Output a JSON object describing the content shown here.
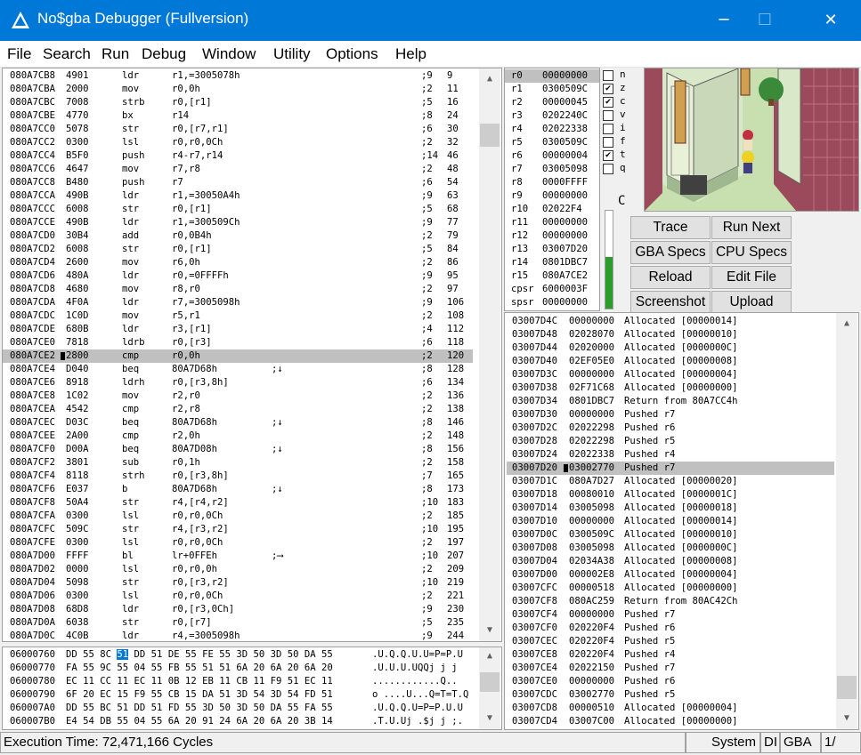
{
  "window": {
    "title": "No$gba Debugger (Fullversion)",
    "minimize": "─",
    "maximize": "☐",
    "close": "✕"
  },
  "menu": [
    "File",
    "Search",
    "Run",
    "Debug",
    "Window",
    "Utility",
    "Options",
    "Help"
  ],
  "disassembly": [
    {
      "addr": "080A7CB8",
      "op": "4901",
      "mn": "ldr",
      "args": "r1,=3005078h",
      "mark": "",
      "cyc": ";9",
      "tot": "9"
    },
    {
      "addr": "080A7CBA",
      "op": "2000",
      "mn": "mov",
      "args": "r0,0h",
      "mark": "",
      "cyc": ";2",
      "tot": "11"
    },
    {
      "addr": "080A7CBC",
      "op": "7008",
      "mn": "strb",
      "args": "r0,[r1]",
      "mark": "",
      "cyc": ";5",
      "tot": "16"
    },
    {
      "addr": "080A7CBE",
      "op": "4770",
      "mn": "bx",
      "args": "r14",
      "mark": "",
      "cyc": ";8",
      "tot": "24"
    },
    {
      "addr": "080A7CC0",
      "op": "5078",
      "mn": "str",
      "args": "r0,[r7,r1]",
      "mark": "",
      "cyc": ";6",
      "tot": "30"
    },
    {
      "addr": "080A7CC2",
      "op": "0300",
      "mn": "lsl",
      "args": "r0,r0,0Ch",
      "mark": "",
      "cyc": ";2",
      "tot": "32"
    },
    {
      "addr": "080A7CC4",
      "op": "B5F0",
      "mn": "push",
      "args": "r4-r7,r14",
      "mark": "",
      "cyc": ";14",
      "tot": "46"
    },
    {
      "addr": "080A7CC6",
      "op": "4647",
      "mn": "mov",
      "args": "r7,r8",
      "mark": "",
      "cyc": ";2",
      "tot": "48"
    },
    {
      "addr": "080A7CC8",
      "op": "B480",
      "mn": "push",
      "args": "r7",
      "mark": "",
      "cyc": ";6",
      "tot": "54"
    },
    {
      "addr": "080A7CCA",
      "op": "490B",
      "mn": "ldr",
      "args": "r1,=30050A4h",
      "mark": "",
      "cyc": ";9",
      "tot": "63"
    },
    {
      "addr": "080A7CCC",
      "op": "6008",
      "mn": "str",
      "args": "r0,[r1]",
      "mark": "",
      "cyc": ";5",
      "tot": "68"
    },
    {
      "addr": "080A7CCE",
      "op": "490B",
      "mn": "ldr",
      "args": "r1,=300509Ch",
      "mark": "",
      "cyc": ";9",
      "tot": "77"
    },
    {
      "addr": "080A7CD0",
      "op": "30B4",
      "mn": "add",
      "args": "r0,0B4h",
      "mark": "",
      "cyc": ";2",
      "tot": "79"
    },
    {
      "addr": "080A7CD2",
      "op": "6008",
      "mn": "str",
      "args": "r0,[r1]",
      "mark": "",
      "cyc": ";5",
      "tot": "84"
    },
    {
      "addr": "080A7CD4",
      "op": "2600",
      "mn": "mov",
      "args": "r6,0h",
      "mark": "",
      "cyc": ";2",
      "tot": "86"
    },
    {
      "addr": "080A7CD6",
      "op": "480A",
      "mn": "ldr",
      "args": "r0,=0FFFFh",
      "mark": "",
      "cyc": ";9",
      "tot": "95"
    },
    {
      "addr": "080A7CD8",
      "op": "4680",
      "mn": "mov",
      "args": "r8,r0",
      "mark": "",
      "cyc": ";2",
      "tot": "97"
    },
    {
      "addr": "080A7CDA",
      "op": "4F0A",
      "mn": "ldr",
      "args": "r7,=3005098h",
      "mark": "",
      "cyc": ";9",
      "tot": "106"
    },
    {
      "addr": "080A7CDC",
      "op": "1C0D",
      "mn": "mov",
      "args": "r5,r1",
      "mark": "",
      "cyc": ";2",
      "tot": "108"
    },
    {
      "addr": "080A7CDE",
      "op": "680B",
      "mn": "ldr",
      "args": "r3,[r1]",
      "mark": "",
      "cyc": ";4",
      "tot": "112"
    },
    {
      "addr": "080A7CE0",
      "op": "7818",
      "mn": "ldrb",
      "args": "r0,[r3]",
      "mark": "",
      "cyc": ";6",
      "tot": "118"
    },
    {
      "addr": "080A7CE2",
      "op": "2800",
      "mn": "cmp",
      "args": "r0,0h",
      "mark": "",
      "cyc": ";2",
      "tot": "120",
      "cursor": true
    },
    {
      "addr": "080A7CE4",
      "op": "D040",
      "mn": "beq",
      "args": "80A7D68h",
      "mark": ";↓",
      "cyc": ";8",
      "tot": "128"
    },
    {
      "addr": "080A7CE6",
      "op": "8918",
      "mn": "ldrh",
      "args": "r0,[r3,8h]",
      "mark": "",
      "cyc": ";6",
      "tot": "134"
    },
    {
      "addr": "080A7CE8",
      "op": "1C02",
      "mn": "mov",
      "args": "r2,r0",
      "mark": "",
      "cyc": ";2",
      "tot": "136"
    },
    {
      "addr": "080A7CEA",
      "op": "4542",
      "mn": "cmp",
      "args": "r2,r8",
      "mark": "",
      "cyc": ";2",
      "tot": "138"
    },
    {
      "addr": "080A7CEC",
      "op": "D03C",
      "mn": "beq",
      "args": "80A7D68h",
      "mark": ";↓",
      "cyc": ";8",
      "tot": "146"
    },
    {
      "addr": "080A7CEE",
      "op": "2A00",
      "mn": "cmp",
      "args": "r2,0h",
      "mark": "",
      "cyc": ";2",
      "tot": "148"
    },
    {
      "addr": "080A7CF0",
      "op": "D00A",
      "mn": "beq",
      "args": "80A7D08h",
      "mark": ";↓",
      "cyc": ";8",
      "tot": "156"
    },
    {
      "addr": "080A7CF2",
      "op": "3801",
      "mn": "sub",
      "args": "r0,1h",
      "mark": "",
      "cyc": ";2",
      "tot": "158"
    },
    {
      "addr": "080A7CF4",
      "op": "8118",
      "mn": "strh",
      "args": "r0,[r3,8h]",
      "mark": "",
      "cyc": ";7",
      "tot": "165"
    },
    {
      "addr": "080A7CF6",
      "op": "E037",
      "mn": "b",
      "args": "80A7D68h",
      "mark": ";↓",
      "cyc": ";8",
      "tot": "173"
    },
    {
      "addr": "080A7CF8",
      "op": "50A4",
      "mn": "str",
      "args": "r4,[r4,r2]",
      "mark": "",
      "cyc": ";10",
      "tot": "183"
    },
    {
      "addr": "080A7CFA",
      "op": "0300",
      "mn": "lsl",
      "args": "r0,r0,0Ch",
      "mark": "",
      "cyc": ";2",
      "tot": "185"
    },
    {
      "addr": "080A7CFC",
      "op": "509C",
      "mn": "str",
      "args": "r4,[r3,r2]",
      "mark": "",
      "cyc": ";10",
      "tot": "195"
    },
    {
      "addr": "080A7CFE",
      "op": "0300",
      "mn": "lsl",
      "args": "r0,r0,0Ch",
      "mark": "",
      "cyc": ";2",
      "tot": "197"
    },
    {
      "addr": "080A7D00",
      "op": "FFFF",
      "mn": "bl",
      "args": "lr+0FFEh",
      "mark": ";⟶",
      "cyc": ";10",
      "tot": "207"
    },
    {
      "addr": "080A7D02",
      "op": "0000",
      "mn": "lsl",
      "args": "r0,r0,0h",
      "mark": "",
      "cyc": ";2",
      "tot": "209"
    },
    {
      "addr": "080A7D04",
      "op": "5098",
      "mn": "str",
      "args": "r0,[r3,r2]",
      "mark": "",
      "cyc": ";10",
      "tot": "219"
    },
    {
      "addr": "080A7D06",
      "op": "0300",
      "mn": "lsl",
      "args": "r0,r0,0Ch",
      "mark": "",
      "cyc": ";2",
      "tot": "221"
    },
    {
      "addr": "080A7D08",
      "op": "68D8",
      "mn": "ldr",
      "args": "r0,[r3,0Ch]",
      "mark": "",
      "cyc": ";9",
      "tot": "230"
    },
    {
      "addr": "080A7D0A",
      "op": "6038",
      "mn": "str",
      "args": "r0,[r7]",
      "mark": "",
      "cyc": ";5",
      "tot": "235"
    },
    {
      "addr": "080A7D0C",
      "op": "4C0B",
      "mn": "ldr",
      "args": "r4,=3005098h",
      "mark": "",
      "cyc": ";9",
      "tot": "244"
    }
  ],
  "registers": [
    {
      "name": "r0",
      "val": "00000000"
    },
    {
      "name": "r1",
      "val": "0300509C"
    },
    {
      "name": "r2",
      "val": "00000045"
    },
    {
      "name": "r3",
      "val": "0202240C"
    },
    {
      "name": "r4",
      "val": "02022338"
    },
    {
      "name": "r5",
      "val": "0300509C"
    },
    {
      "name": "r6",
      "val": "00000004"
    },
    {
      "name": "r7",
      "val": "03005098"
    },
    {
      "name": "r8",
      "val": "0000FFFF"
    },
    {
      "name": "r9",
      "val": "00000000"
    },
    {
      "name": "r10",
      "val": "02022F4"
    },
    {
      "name": "r11",
      "val": "00000000"
    },
    {
      "name": "r12",
      "val": "00000000"
    },
    {
      "name": "r13",
      "val": "03007D20"
    },
    {
      "name": "r14",
      "val": "0801DBC7"
    },
    {
      "name": "r15",
      "val": "080A7CE2"
    },
    {
      "name": "cpsr",
      "val": "6000003F"
    },
    {
      "name": "spsr",
      "val": "00000000"
    }
  ],
  "flags": [
    {
      "letter": "n",
      "checked": false
    },
    {
      "letter": "z",
      "checked": true
    },
    {
      "letter": "c",
      "checked": true
    },
    {
      "letter": "v",
      "checked": false
    },
    {
      "letter": "i",
      "checked": false
    },
    {
      "letter": "f",
      "checked": false
    },
    {
      "letter": "t",
      "checked": true
    },
    {
      "letter": "q",
      "checked": false
    }
  ],
  "flag_extra": "C",
  "buttons": [
    "Trace",
    "Run Next",
    "GBA Specs",
    "CPU Specs",
    "Reload",
    "Edit File",
    "Screenshot",
    "Upload"
  ],
  "stack": [
    {
      "addr": "03007D4C",
      "val": "00000000",
      "desc": "Allocated [00000014]"
    },
    {
      "addr": "03007D48",
      "val": "02028070",
      "desc": "Allocated [00000010]"
    },
    {
      "addr": "03007D44",
      "val": "02020000",
      "desc": "Allocated [0000000C]"
    },
    {
      "addr": "03007D40",
      "val": "02EF05E0",
      "desc": "Allocated [00000008]"
    },
    {
      "addr": "03007D3C",
      "val": "00000000",
      "desc": "Allocated [00000004]"
    },
    {
      "addr": "03007D38",
      "val": "02F71C68",
      "desc": "Allocated [00000000]"
    },
    {
      "addr": "03007D34",
      "val": "0801DBC7",
      "desc": "Return from 80A7CC4h"
    },
    {
      "addr": "03007D30",
      "val": "00000000",
      "desc": "Pushed r7"
    },
    {
      "addr": "03007D2C",
      "val": "02022298",
      "desc": "Pushed r6"
    },
    {
      "addr": "03007D28",
      "val": "02022298",
      "desc": "Pushed r5"
    },
    {
      "addr": "03007D24",
      "val": "02022338",
      "desc": "Pushed r4"
    },
    {
      "addr": "03007D20",
      "val": "03002770",
      "desc": "Pushed r7",
      "sel": true
    },
    {
      "addr": "03007D1C",
      "val": "080A7D27",
      "desc": "Allocated [00000020]"
    },
    {
      "addr": "03007D18",
      "val": "00080010",
      "desc": "Allocated [0000001C]"
    },
    {
      "addr": "03007D14",
      "val": "03005098",
      "desc": "Allocated [00000018]"
    },
    {
      "addr": "03007D10",
      "val": "00000000",
      "desc": "Allocated [00000014]"
    },
    {
      "addr": "03007D0C",
      "val": "0300509C",
      "desc": "Allocated [00000010]"
    },
    {
      "addr": "03007D08",
      "val": "03005098",
      "desc": "Allocated [0000000C]"
    },
    {
      "addr": "03007D04",
      "val": "02034A38",
      "desc": "Allocated [00000008]"
    },
    {
      "addr": "03007D00",
      "val": "000002E8",
      "desc": "Allocated [00000004]"
    },
    {
      "addr": "03007CFC",
      "val": "00000518",
      "desc": "Allocated [00000000]"
    },
    {
      "addr": "03007CF8",
      "val": "080AC259",
      "desc": "Return from 80AC42Ch"
    },
    {
      "addr": "03007CF4",
      "val": "00000000",
      "desc": "Pushed r7"
    },
    {
      "addr": "03007CF0",
      "val": "020220F4",
      "desc": "Pushed r6"
    },
    {
      "addr": "03007CEC",
      "val": "020220F4",
      "desc": "Pushed r5"
    },
    {
      "addr": "03007CE8",
      "val": "020220F4",
      "desc": "Pushed r4"
    },
    {
      "addr": "03007CE4",
      "val": "02022150",
      "desc": "Pushed r7"
    },
    {
      "addr": "03007CE0",
      "val": "00000000",
      "desc": "Pushed r6"
    },
    {
      "addr": "03007CDC",
      "val": "03002770",
      "desc": "Pushed r5"
    },
    {
      "addr": "03007CD8",
      "val": "00000510",
      "desc": "Allocated [00000004]"
    },
    {
      "addr": "03007CD4",
      "val": "03007C00",
      "desc": "Allocated [00000000]"
    }
  ],
  "hexdump": [
    {
      "addr": "06000760",
      "pre": "DD 55 8C ",
      "hl": "51",
      "post": " DD 51 DE 55 FE 55 3D 50 3D 50 DA 55",
      "ascii": ".U.Q.Q.U.U=P=P.U"
    },
    {
      "addr": "06000770",
      "pre": "FA 55 9C 55 04 55 FB 55 51 51 6A 20 6A 20 6A 20",
      "hl": "",
      "post": "",
      "ascii": ".U.U.U.UQQj j j "
    },
    {
      "addr": "06000780",
      "pre": "EC 11 CC 11 EC 11 0B 12 EB 11 CB 11 F9 51 EC 11",
      "hl": "",
      "post": "",
      "ascii": "............Q.."
    },
    {
      "addr": "06000790",
      "pre": "6F 20 EC 15 F9 55 CB 15 DA 51 3D 54 3D 54 FD 51",
      "hl": "",
      "post": "",
      "ascii": "o ....U...Q=T=T.Q"
    },
    {
      "addr": "060007A0",
      "pre": "DD 55 BC 51 DD 51 FD 55 3D 50 3D 50 DA 55 FA 55",
      "hl": "",
      "post": "",
      "ascii": ".U.Q.Q.U=P=P.U.U"
    },
    {
      "addr": "060007B0",
      "pre": "E4 54 DB 55 04 55 6A 20 91 24 6A 20 6A 20 3B 14",
      "hl": "",
      "post": "",
      "ascii": ".T.U.Uj .$j j ;."
    }
  ],
  "status": {
    "execution": "Execution Time: 72,471,166 Cycles",
    "system": "System",
    "di": "DI",
    "gba": "GBA",
    "page": "1/"
  }
}
